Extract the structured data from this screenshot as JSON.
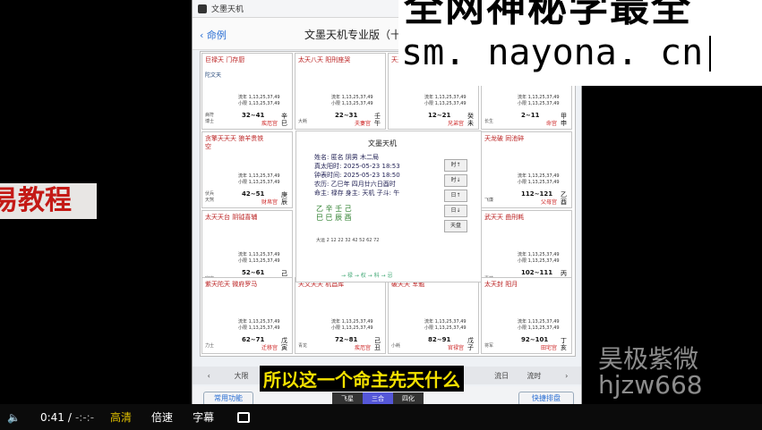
{
  "left_banner": {
    "text": "易教程"
  },
  "app": {
    "window_title": "文墨天机",
    "back_label": "命例",
    "nav_title": "文墨天机专业版（十",
    "cells": [
      {
        "stars": "巨禄天 门存厨",
        "stars2": "陀文天",
        "range": "32~41",
        "palace": "疾厄宫",
        "gz": "辛巳",
        "side": "病符 博士"
      },
      {
        "stars": "太天八天 阳刑座哭",
        "stars2": "",
        "range": "22~31",
        "palace": "夫妻宫",
        "gz": "壬午",
        "side": "大耗"
      },
      {
        "stars": "天天天天 钺福巫",
        "stars2": "",
        "range": "12~21",
        "palace": "兄弟宫",
        "gz": "癸未",
        "side": ""
      },
      {
        "stars": "地天天天 劫机喜厨",
        "stars2": "",
        "range": "2~11",
        "palace": "命宫",
        "gz": "甲申",
        "side": "长生"
      },
      {
        "stars": "贪擎天天天 狼羊贵铁空",
        "stars2": "",
        "range": "42~51",
        "palace": "财帛宫",
        "gz": "庚辰",
        "side": "伏兵 天煞"
      },
      {
        "stars": "天龙破 同池碎",
        "stars2": "",
        "range": "112~121",
        "palace": "父母宫",
        "gz": "乙酉",
        "side": "飞廉"
      },
      {
        "stars": "太天天台 阴钺喜辅",
        "stars2": "",
        "range": "52~61",
        "palace": "子女宫",
        "gz": "己卯",
        "side": "官府"
      },
      {
        "stars": "武天天 曲刑耗",
        "stars2": "",
        "range": "102~111",
        "palace": "福德宫",
        "gz": "丙戌",
        "side": "喜神"
      },
      {
        "stars": "紫天陀天 微府罗马",
        "stars2": "",
        "range": "62~71",
        "palace": "迁移宫",
        "gz": "戊寅",
        "side": "力士"
      },
      {
        "stars": "天文天天 机昌库",
        "stars2": "",
        "range": "72~81",
        "palace": "疾厄宫",
        "gz": "己丑",
        "side": "青龙"
      },
      {
        "stars": "破天天 军魁",
        "stars2": "",
        "range": "82~91",
        "palace": "官禄宫",
        "gz": "戊子",
        "side": "小耗"
      },
      {
        "stars": "太天封 阳月",
        "stars2": "",
        "range": "92~101",
        "palace": "田宅宫",
        "gz": "丁亥",
        "side": "将军"
      }
    ],
    "liunian": "流年 1,13,25,37,49\n小限 1,13,25,37,49",
    "center": {
      "title": "文墨天机",
      "info": [
        "姓名: 匿名     阴男 木二局",
        "真太阳时: 2025-05-23 18:53",
        "钟表时间: 2025-05-23 18:50",
        "农历: 乙巳年 四月廿六日酉时",
        "命主: 禄存 身主: 天机 子斗: 午"
      ],
      "pillars": "乙 辛 壬 己\n巳 巳 辰 酉",
      "luck": "大运 2 12 22 32 42 52 62 72",
      "flow": "→ 禄 → 权 → 科 → 忌"
    },
    "tool_buttons": [
      "时↑",
      "时↓",
      "日↑",
      "日↓",
      "天盘"
    ],
    "bottom_tabs": [
      "大限",
      "",
      "",
      "",
      "",
      "流年",
      "",
      "",
      "流日",
      "流时"
    ],
    "btn_left": "常用功能",
    "segment": [
      "飞星",
      "三合",
      "四化"
    ],
    "btn_right": "快捷排盘"
  },
  "watermarks": {
    "top": "全网神秘学最全",
    "url": "sm. nayona. cn",
    "br_line1": "昊极紫微",
    "br_line2": "hjzw668"
  },
  "subtitle": "所以这一个命主先天什么",
  "player": {
    "time": "0:41",
    "sep": "/",
    "total": "-:-:-",
    "quality": "高清",
    "speed": "倍速",
    "captions": "字幕"
  }
}
